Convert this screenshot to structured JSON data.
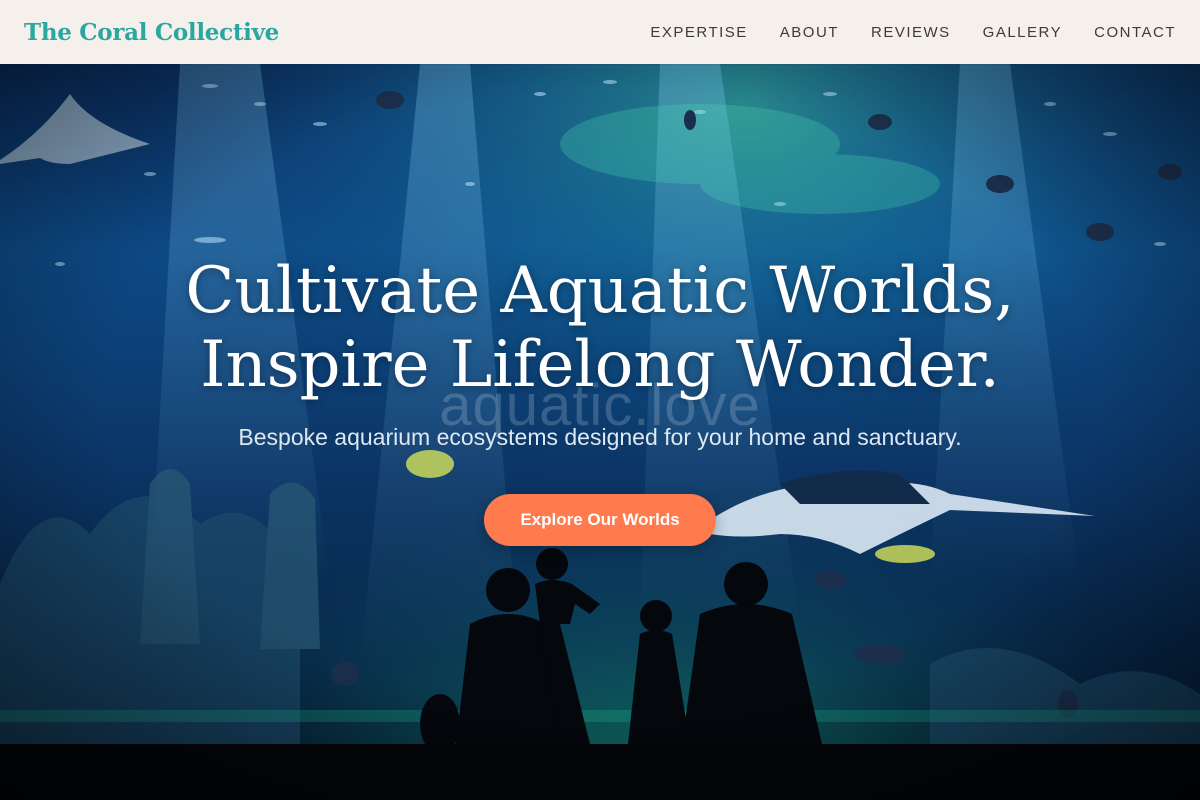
{
  "header": {
    "brand": "The Coral Collective",
    "nav": [
      {
        "label": "EXPERTISE"
      },
      {
        "label": "ABOUT"
      },
      {
        "label": "REVIEWS"
      },
      {
        "label": "GALLERY"
      },
      {
        "label": "CONTACT"
      }
    ]
  },
  "hero": {
    "headline_line1": "Cultivate Aquatic Worlds,",
    "headline_line2": "Inspire Lifelong Wonder.",
    "watermark": "aquatic.love",
    "subheadline": "Bespoke aquarium ecosystems designed for your home and sanctuary.",
    "cta_label": "Explore Our Worlds"
  },
  "colors": {
    "brand": "#2aa8a0",
    "header_bg": "#f5f0eb",
    "cta": "#ff7b4d",
    "water_deep": "#041a3a",
    "water_light": "#1f6fb0"
  }
}
